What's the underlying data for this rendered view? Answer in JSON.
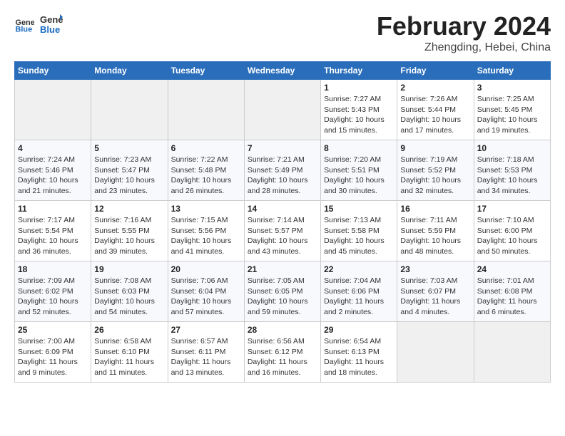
{
  "logo": {
    "general": "General",
    "blue": "Blue"
  },
  "title": "February 2024",
  "subtitle": "Zhengding, Hebei, China",
  "header_days": [
    "Sunday",
    "Monday",
    "Tuesday",
    "Wednesday",
    "Thursday",
    "Friday",
    "Saturday"
  ],
  "weeks": [
    [
      {
        "day": "",
        "info": ""
      },
      {
        "day": "",
        "info": ""
      },
      {
        "day": "",
        "info": ""
      },
      {
        "day": "",
        "info": ""
      },
      {
        "day": "1",
        "info": "Sunrise: 7:27 AM\nSunset: 5:43 PM\nDaylight: 10 hours\nand 15 minutes."
      },
      {
        "day": "2",
        "info": "Sunrise: 7:26 AM\nSunset: 5:44 PM\nDaylight: 10 hours\nand 17 minutes."
      },
      {
        "day": "3",
        "info": "Sunrise: 7:25 AM\nSunset: 5:45 PM\nDaylight: 10 hours\nand 19 minutes."
      }
    ],
    [
      {
        "day": "4",
        "info": "Sunrise: 7:24 AM\nSunset: 5:46 PM\nDaylight: 10 hours\nand 21 minutes."
      },
      {
        "day": "5",
        "info": "Sunrise: 7:23 AM\nSunset: 5:47 PM\nDaylight: 10 hours\nand 23 minutes."
      },
      {
        "day": "6",
        "info": "Sunrise: 7:22 AM\nSunset: 5:48 PM\nDaylight: 10 hours\nand 26 minutes."
      },
      {
        "day": "7",
        "info": "Sunrise: 7:21 AM\nSunset: 5:49 PM\nDaylight: 10 hours\nand 28 minutes."
      },
      {
        "day": "8",
        "info": "Sunrise: 7:20 AM\nSunset: 5:51 PM\nDaylight: 10 hours\nand 30 minutes."
      },
      {
        "day": "9",
        "info": "Sunrise: 7:19 AM\nSunset: 5:52 PM\nDaylight: 10 hours\nand 32 minutes."
      },
      {
        "day": "10",
        "info": "Sunrise: 7:18 AM\nSunset: 5:53 PM\nDaylight: 10 hours\nand 34 minutes."
      }
    ],
    [
      {
        "day": "11",
        "info": "Sunrise: 7:17 AM\nSunset: 5:54 PM\nDaylight: 10 hours\nand 36 minutes."
      },
      {
        "day": "12",
        "info": "Sunrise: 7:16 AM\nSunset: 5:55 PM\nDaylight: 10 hours\nand 39 minutes."
      },
      {
        "day": "13",
        "info": "Sunrise: 7:15 AM\nSunset: 5:56 PM\nDaylight: 10 hours\nand 41 minutes."
      },
      {
        "day": "14",
        "info": "Sunrise: 7:14 AM\nSunset: 5:57 PM\nDaylight: 10 hours\nand 43 minutes."
      },
      {
        "day": "15",
        "info": "Sunrise: 7:13 AM\nSunset: 5:58 PM\nDaylight: 10 hours\nand 45 minutes."
      },
      {
        "day": "16",
        "info": "Sunrise: 7:11 AM\nSunset: 5:59 PM\nDaylight: 10 hours\nand 48 minutes."
      },
      {
        "day": "17",
        "info": "Sunrise: 7:10 AM\nSunset: 6:00 PM\nDaylight: 10 hours\nand 50 minutes."
      }
    ],
    [
      {
        "day": "18",
        "info": "Sunrise: 7:09 AM\nSunset: 6:02 PM\nDaylight: 10 hours\nand 52 minutes."
      },
      {
        "day": "19",
        "info": "Sunrise: 7:08 AM\nSunset: 6:03 PM\nDaylight: 10 hours\nand 54 minutes."
      },
      {
        "day": "20",
        "info": "Sunrise: 7:06 AM\nSunset: 6:04 PM\nDaylight: 10 hours\nand 57 minutes."
      },
      {
        "day": "21",
        "info": "Sunrise: 7:05 AM\nSunset: 6:05 PM\nDaylight: 10 hours\nand 59 minutes."
      },
      {
        "day": "22",
        "info": "Sunrise: 7:04 AM\nSunset: 6:06 PM\nDaylight: 11 hours\nand 2 minutes."
      },
      {
        "day": "23",
        "info": "Sunrise: 7:03 AM\nSunset: 6:07 PM\nDaylight: 11 hours\nand 4 minutes."
      },
      {
        "day": "24",
        "info": "Sunrise: 7:01 AM\nSunset: 6:08 PM\nDaylight: 11 hours\nand 6 minutes."
      }
    ],
    [
      {
        "day": "25",
        "info": "Sunrise: 7:00 AM\nSunset: 6:09 PM\nDaylight: 11 hours\nand 9 minutes."
      },
      {
        "day": "26",
        "info": "Sunrise: 6:58 AM\nSunset: 6:10 PM\nDaylight: 11 hours\nand 11 minutes."
      },
      {
        "day": "27",
        "info": "Sunrise: 6:57 AM\nSunset: 6:11 PM\nDaylight: 11 hours\nand 13 minutes."
      },
      {
        "day": "28",
        "info": "Sunrise: 6:56 AM\nSunset: 6:12 PM\nDaylight: 11 hours\nand 16 minutes."
      },
      {
        "day": "29",
        "info": "Sunrise: 6:54 AM\nSunset: 6:13 PM\nDaylight: 11 hours\nand 18 minutes."
      },
      {
        "day": "",
        "info": ""
      },
      {
        "day": "",
        "info": ""
      }
    ]
  ]
}
